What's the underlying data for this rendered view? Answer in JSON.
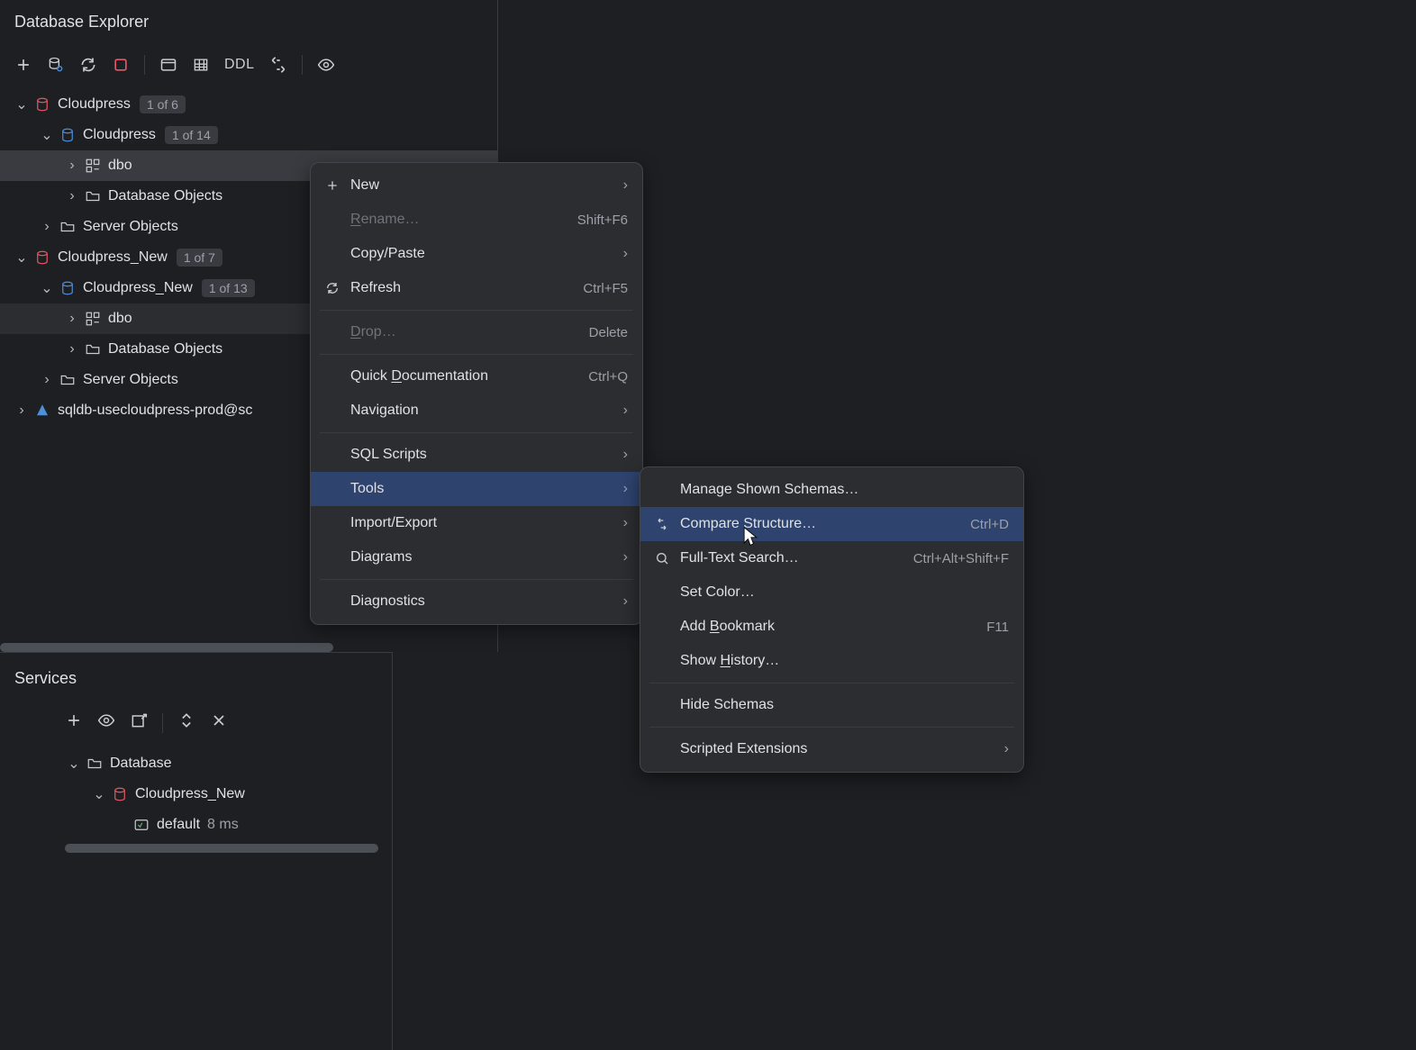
{
  "explorer": {
    "title": "Database Explorer",
    "toolbar": {
      "ddl_label": "DDL"
    },
    "tree": [
      {
        "indent": 0,
        "chev": "down",
        "icon": "db-red",
        "label": "Cloudpress",
        "badge": "1 of 6"
      },
      {
        "indent": 1,
        "chev": "down",
        "icon": "db-blue",
        "label": "Cloudpress",
        "badge": "1 of 14"
      },
      {
        "indent": 2,
        "chev": "right",
        "icon": "schema",
        "label": "dbo",
        "sel": "darker"
      },
      {
        "indent": 2,
        "chev": "right",
        "icon": "folder",
        "label": "Database Objects"
      },
      {
        "indent": 1,
        "chev": "right",
        "icon": "folder",
        "label": "Server Objects"
      },
      {
        "indent": 0,
        "chev": "down",
        "icon": "db-red",
        "label": "Cloudpress_New",
        "badge": "1 of 7"
      },
      {
        "indent": 1,
        "chev": "down",
        "icon": "db-blue",
        "label": "Cloudpress_New",
        "badge": "1 of 13"
      },
      {
        "indent": 2,
        "chev": "right",
        "icon": "schema",
        "label": "dbo",
        "sel": "dark"
      },
      {
        "indent": 2,
        "chev": "right",
        "icon": "folder",
        "label": "Database Objects"
      },
      {
        "indent": 1,
        "chev": "right",
        "icon": "folder",
        "label": "Server Objects"
      },
      {
        "indent": 0,
        "chev": "right",
        "icon": "azure",
        "label": "sqldb-usecloudpress-prod@sc"
      }
    ]
  },
  "ctx_main": {
    "items": [
      {
        "icon": "plus",
        "label": "New",
        "arrow": true
      },
      {
        "label": "Rename…",
        "shortcut": "Shift+F6",
        "disabled": true,
        "u": 0
      },
      {
        "label": "Copy/Paste",
        "arrow": true
      },
      {
        "icon": "refresh",
        "label": "Refresh",
        "shortcut": "Ctrl+F5"
      },
      {
        "sep": true
      },
      {
        "label": "Drop…",
        "shortcut": "Delete",
        "disabled": true,
        "u": 0
      },
      {
        "sep": true
      },
      {
        "label": "Quick Documentation",
        "shortcut": "Ctrl+Q",
        "u": 6
      },
      {
        "label": "Navigation",
        "arrow": true
      },
      {
        "sep": true
      },
      {
        "label": "SQL Scripts",
        "arrow": true
      },
      {
        "label": "Tools",
        "arrow": true,
        "highlight": true
      },
      {
        "label": "Import/Export",
        "arrow": true
      },
      {
        "label": "Diagrams",
        "arrow": true
      },
      {
        "sep": true
      },
      {
        "label": "Diagnostics",
        "arrow": true
      }
    ]
  },
  "ctx_sub": {
    "items": [
      {
        "label": "Manage Shown Schemas…"
      },
      {
        "icon": "compare",
        "label": "Compare Structure…",
        "shortcut": "Ctrl+D",
        "highlight": true
      },
      {
        "icon": "search",
        "label": "Full-Text Search…",
        "shortcut": "Ctrl+Alt+Shift+F"
      },
      {
        "label": "Set Color…"
      },
      {
        "label": "Add Bookmark",
        "shortcut": "F11",
        "u": 4
      },
      {
        "label": "Show History…",
        "u": 5
      },
      {
        "sep": true
      },
      {
        "label": "Hide Schemas"
      },
      {
        "sep": true
      },
      {
        "label": "Scripted Extensions",
        "arrow": true
      }
    ]
  },
  "services": {
    "title": "Services",
    "tree": {
      "root_label": "Database",
      "child_label": "Cloudpress_New",
      "leaf_label": "default",
      "leaf_time": "8 ms"
    }
  }
}
